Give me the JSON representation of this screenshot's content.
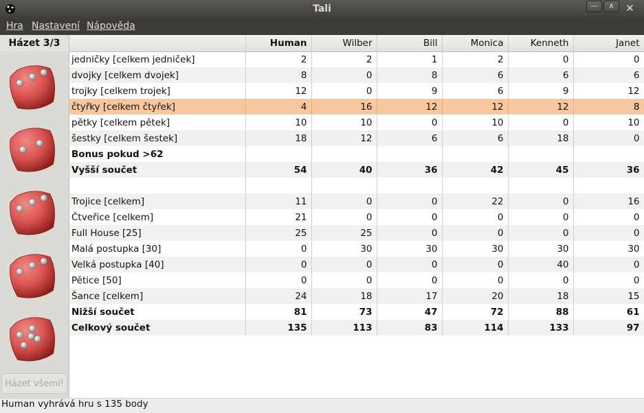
{
  "window": {
    "title": "Tali",
    "app_icon": "dice-app-icon"
  },
  "menu": [
    "Hra",
    "Nastavení",
    "Nápověda"
  ],
  "dice_panel": {
    "roll_label": "Házet 3/3",
    "dice": [
      3,
      2,
      3,
      3,
      5
    ],
    "roll_all_label": "Házet všemi!",
    "die_color": "#d9534f"
  },
  "score_table": {
    "players": [
      "Human",
      "Wilber",
      "Bill",
      "Monica",
      "Kenneth",
      "Janet"
    ],
    "highlight_color": "#f7c79f",
    "rows": [
      {
        "label": "jedničky [celkem jedniček]",
        "values": [
          "2",
          "2",
          "1",
          "2",
          "0",
          "0"
        ]
      },
      {
        "label": "dvojky [celkem dvojek]",
        "values": [
          "8",
          "0",
          "8",
          "6",
          "6",
          "6"
        ]
      },
      {
        "label": "trojky [celkem trojek]",
        "values": [
          "12",
          "0",
          "9",
          "6",
          "9",
          "12"
        ]
      },
      {
        "label": "čtyřky [celkem čtyřek]",
        "values": [
          "4",
          "16",
          "12",
          "12",
          "12",
          "8"
        ],
        "highlight": true
      },
      {
        "label": "pětky [celkem pětek]",
        "values": [
          "10",
          "10",
          "0",
          "10",
          "0",
          "10"
        ]
      },
      {
        "label": "šestky [celkem šestek]",
        "values": [
          "18",
          "12",
          "6",
          "6",
          "18",
          "0"
        ]
      },
      {
        "label": "Bonus pokud >62",
        "values": [
          "",
          "",
          "",
          "",
          "",
          ""
        ],
        "bold": true
      },
      {
        "label": "Vyšší součet",
        "values": [
          "54",
          "40",
          "36",
          "42",
          "45",
          "36"
        ],
        "bold": true
      },
      {
        "label": "",
        "values": [
          "",
          "",
          "",
          "",
          "",
          ""
        ]
      },
      {
        "label": "Trojice [celkem]",
        "values": [
          "11",
          "0",
          "0",
          "22",
          "0",
          "16"
        ]
      },
      {
        "label": "Čtveřice [celkem]",
        "values": [
          "21",
          "0",
          "0",
          "0",
          "0",
          "0"
        ]
      },
      {
        "label": "Full House [25]",
        "values": [
          "25",
          "25",
          "0",
          "0",
          "0",
          "0"
        ]
      },
      {
        "label": "Malá postupka [30]",
        "values": [
          "0",
          "30",
          "30",
          "30",
          "30",
          "30"
        ]
      },
      {
        "label": "Velká postupka [40]",
        "values": [
          "0",
          "0",
          "0",
          "0",
          "40",
          "0"
        ]
      },
      {
        "label": "Pětice [50]",
        "values": [
          "0",
          "0",
          "0",
          "0",
          "0",
          "0"
        ]
      },
      {
        "label": "Šance [celkem]",
        "values": [
          "24",
          "18",
          "17",
          "20",
          "18",
          "15"
        ]
      },
      {
        "label": "Nižší součet",
        "values": [
          "81",
          "73",
          "47",
          "72",
          "88",
          "61"
        ],
        "bold": true
      },
      {
        "label": "Celkový součet",
        "values": [
          "135",
          "113",
          "83",
          "114",
          "133",
          "97"
        ],
        "bold": true
      }
    ]
  },
  "status_text": "Human vyhrává hru s 135 body"
}
